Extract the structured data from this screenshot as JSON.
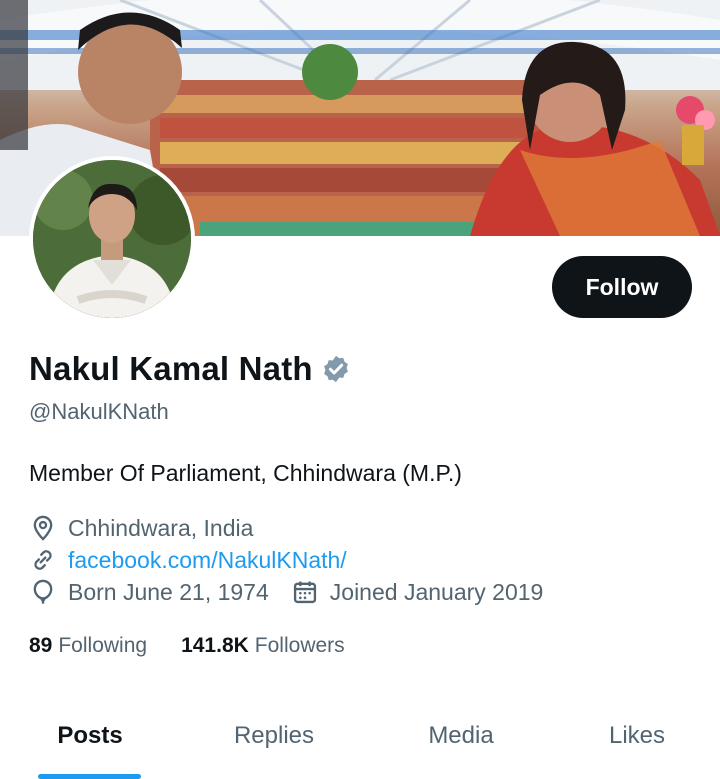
{
  "profile": {
    "name": "Nakul Kamal Nath",
    "handle": "@NakulKNath",
    "bio": "Member Of Parliament, Chhindwara (M.P.)",
    "location": "Chhindwara, India",
    "website": "facebook.com/NakulKNath/",
    "born": "Born June 21, 1974",
    "joined": "Joined January 2019",
    "verified_icon": "verified-badge-icon"
  },
  "actions": {
    "follow_label": "Follow"
  },
  "stats": {
    "following_count": "89",
    "following_label": "Following",
    "followers_count": "141.8K",
    "followers_label": "Followers"
  },
  "tabs": [
    {
      "label": "Posts",
      "active": true
    },
    {
      "label": "Replies",
      "active": false
    },
    {
      "label": "Media",
      "active": false
    },
    {
      "label": "Likes",
      "active": false
    }
  ],
  "colors": {
    "accent": "#1d9bf0",
    "text_primary": "#0f1419",
    "text_secondary": "#536471",
    "button_bg": "#0f1419"
  }
}
